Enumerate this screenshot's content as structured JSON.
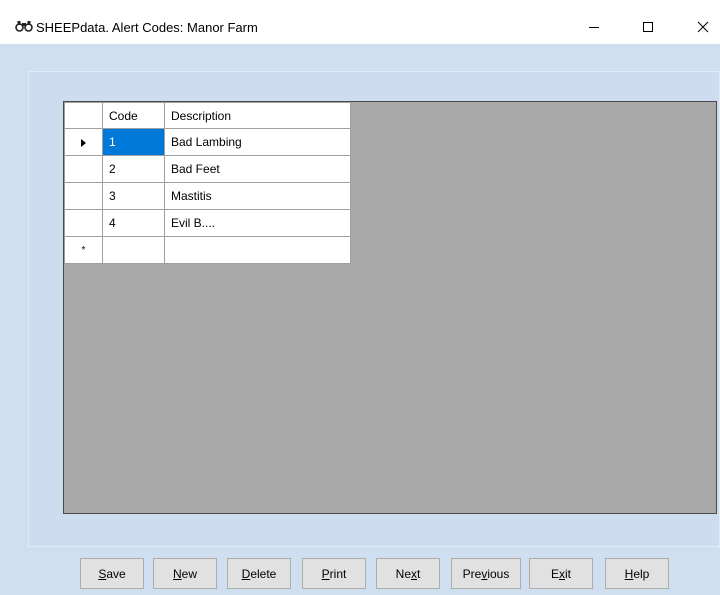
{
  "window": {
    "title": "SHEEPdata. Alert Codes: Manor Farm",
    "icon": "binoculars-icon",
    "controls": {
      "minimize": "minimize-icon",
      "maximize": "maximize-icon",
      "close": "close-icon"
    }
  },
  "grid": {
    "columns": [
      "Code",
      "Description"
    ],
    "rows": [
      {
        "code": "1",
        "description": "Bad Lambing"
      },
      {
        "code": "2",
        "description": "Bad Feet"
      },
      {
        "code": "3",
        "description": "Mastitis"
      },
      {
        "code": "4",
        "description": "Evil B...."
      }
    ],
    "new_row_marker": "*"
  },
  "buttons": {
    "save": {
      "accel": "S",
      "rest": "ave"
    },
    "new": {
      "accel": "N",
      "rest": "ew"
    },
    "delete": {
      "accel": "D",
      "rest": "elete"
    },
    "print": {
      "accel": "P",
      "rest": "rint"
    },
    "next": {
      "pre": "Ne",
      "accel": "x",
      "rest": "t"
    },
    "previous": {
      "pre": "Pre",
      "accel": "v",
      "rest": "ious"
    },
    "exit": {
      "pre": "E",
      "accel": "x",
      "rest": "it"
    },
    "help": {
      "accel": "H",
      "rest": "elp"
    }
  },
  "colors": {
    "selection": "#0078d7",
    "client_bg": "#cfdff0",
    "grid_bg": "#a9a9a9"
  }
}
